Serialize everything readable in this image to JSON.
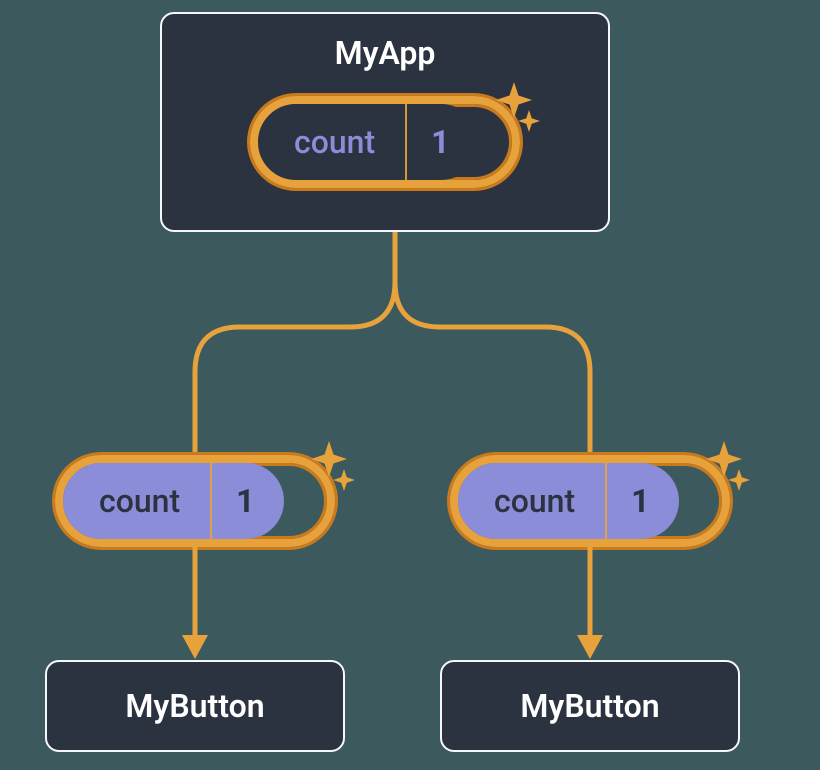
{
  "root": {
    "title": "MyApp",
    "state": {
      "label": "count",
      "value": "1"
    }
  },
  "children": [
    {
      "prop": {
        "label": "count",
        "value": "1"
      },
      "target": "MyButton"
    },
    {
      "prop": {
        "label": "count",
        "value": "1"
      },
      "target": "MyButton"
    }
  ],
  "icons": {
    "sparkle": "sparkle-icon"
  },
  "colors": {
    "box_bg": "#2b3240",
    "box_border": "#f5f7fa",
    "accent": "#e8a23c",
    "accent_dark": "#c97a1c",
    "pill_light_fill": "#8b8dd8",
    "text_light": "#ffffff",
    "text_lavender": "#8b8dd8",
    "bg": "#3c5a5e"
  }
}
